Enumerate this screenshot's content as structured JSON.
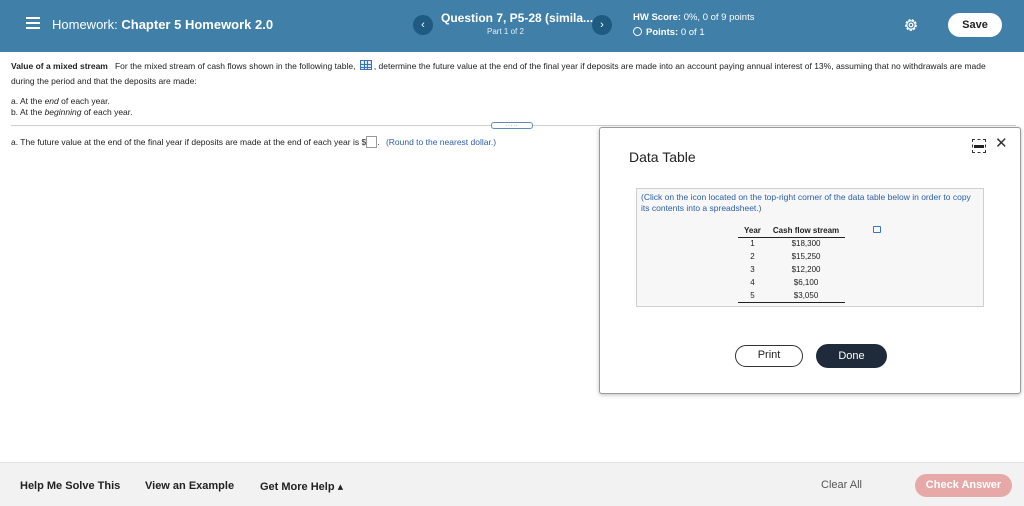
{
  "header": {
    "homework_prefix": "Homework:",
    "homework_title": "Chapter 5 Homework 2.0",
    "question_title": "Question 7, P5-28 (simila...",
    "question_part": "Part 1 of 2",
    "hw_score_label": "HW Score:",
    "hw_score_value": "0%, 0 of 9 points",
    "points_label": "Points:",
    "points_value": "0 of 1",
    "save_label": "Save",
    "prev_icon": "chevron-left-icon",
    "next_icon": "chevron-right-icon",
    "settings_icon": "gear-icon",
    "prev_symbol": "‹",
    "next_symbol": "›"
  },
  "question": {
    "topic": "Value of a mixed stream",
    "text_before_icon": "For the mixed stream of cash flows shown in the following table,",
    "text_after_icon": ", determine the future value at the end of the final year if deposits are made into an account paying annual interest of 13%, assuming that no withdrawals are made during the period and that the deposits are made:",
    "part_a_prefix": "a.  At the",
    "part_a_em": "end",
    "part_a_suffix": "of each year.",
    "part_b_prefix": "b.  At the",
    "part_b_em": "beginning",
    "part_b_suffix": "of each year.",
    "answer_prefix": "a.  The future value at the end of the final year if deposits are made at the end of each year is $",
    "answer_suffix": ".",
    "round_hint": "(Round to the nearest dollar.)",
    "divider_handle": "....."
  },
  "dialog": {
    "title": "Data Table",
    "hint": "(Click on the icon located on the top-right corner of the data table below in order to copy its contents into a spreadsheet.)",
    "columns": [
      "Year",
      "Cash flow stream"
    ],
    "rows": [
      [
        "1",
        "$18,300"
      ],
      [
        "2",
        "$15,250"
      ],
      [
        "3",
        "$12,200"
      ],
      [
        "4",
        "$6,100"
      ],
      [
        "5",
        "$3,050"
      ]
    ],
    "print_label": "Print",
    "done_label": "Done",
    "close_symbol": "✕"
  },
  "footer": {
    "help_solve": "Help Me Solve This",
    "view_example": "View an Example",
    "get_more_help": "Get More Help ▴",
    "clear_all": "Clear All",
    "check_answer": "Check Answer"
  },
  "colors": {
    "header_bg": "#3f7fa8",
    "nav_button": "#1f5a80",
    "done_button": "#1f2b3a",
    "check_answer_disabled": "#e7a8a8",
    "link_blue": "#2a5fa8"
  }
}
